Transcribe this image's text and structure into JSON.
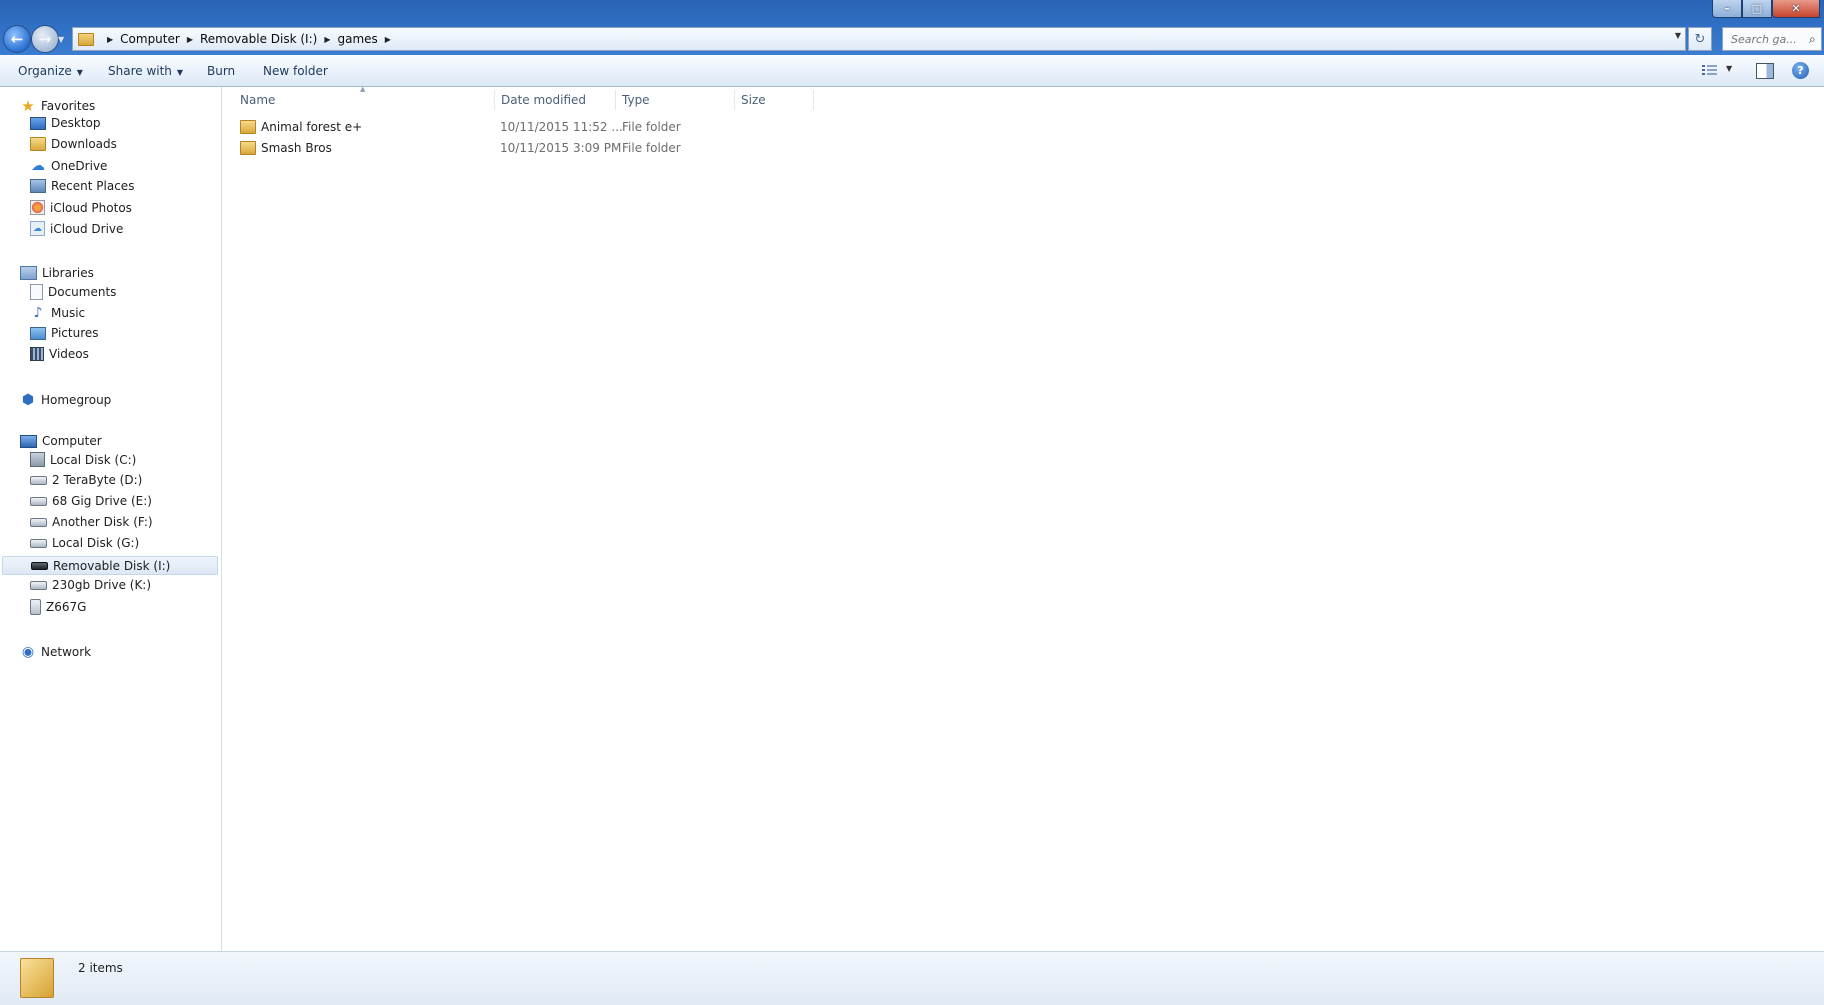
{
  "address": {
    "breadcrumbs": [
      "Computer",
      "Removable Disk (I:)",
      "games"
    ],
    "search_placeholder": "Search ga..."
  },
  "toolbar": {
    "organize": "Organize",
    "share_with": "Share with",
    "burn": "Burn",
    "new_folder": "New folder"
  },
  "window_controls": {
    "minimize": "–",
    "maximize": "□",
    "close": "✕"
  },
  "nav": {
    "favorites": {
      "label": "Favorites",
      "items": [
        "Desktop",
        "Downloads",
        "OneDrive",
        "Recent Places",
        "iCloud Photos",
        "iCloud Drive"
      ]
    },
    "libraries": {
      "label": "Libraries",
      "items": [
        "Documents",
        "Music",
        "Pictures",
        "Videos"
      ]
    },
    "homegroup": "Homegroup",
    "computer": {
      "label": "Computer",
      "items": [
        "Local Disk (C:)",
        "2 TeraByte (D:)",
        "68 Gig Drive (E:)",
        "Another Disk (F:)",
        "Local Disk (G:)",
        "Removable Disk (I:)",
        "230gb Drive (K:)",
        "Z667G"
      ],
      "selected": "Removable Disk (I:)"
    },
    "network": "Network"
  },
  "columns": {
    "name": "Name",
    "date_modified": "Date modified",
    "type": "Type",
    "size": "Size"
  },
  "files": [
    {
      "name": "Animal forest e+",
      "date": "10/11/2015 11:52 ...",
      "type": "File folder"
    },
    {
      "name": "Smash Bros",
      "date": "10/11/2015 3:09 PM",
      "type": "File folder"
    }
  ],
  "status": {
    "item_count": "2 items"
  }
}
